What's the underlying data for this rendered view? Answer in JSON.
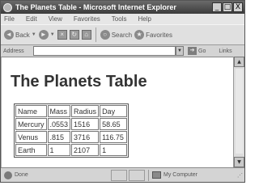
{
  "window": {
    "title": "The Planets Table - Microsoft Internet Explorer",
    "controls": {
      "minimize": "_",
      "maximize": "□",
      "close": "X"
    }
  },
  "menu": [
    "File",
    "Edit",
    "View",
    "Favorites",
    "Tools",
    "Help"
  ],
  "toolbar": {
    "back_label": "Back",
    "search_label": "Search",
    "favorites_label": "Favorites"
  },
  "address": {
    "label": "Address",
    "value": "",
    "go_label": "Go",
    "links_label": "Links"
  },
  "page": {
    "title": "The Planets Table",
    "table": {
      "rows": [
        [
          "Name",
          "Mass",
          "Radius",
          "Day"
        ],
        [
          "Mercury",
          ".0553",
          "1516",
          "58.65"
        ],
        [
          "Venus",
          ".815",
          "3716",
          "116.75"
        ],
        [
          "Earth",
          "1",
          "2107",
          "1"
        ]
      ]
    }
  },
  "status": {
    "left_text": "Done",
    "zone_text": "My Computer"
  },
  "icons": {
    "stop": "stop-icon",
    "refresh": "refresh-icon",
    "home": "home-icon"
  }
}
